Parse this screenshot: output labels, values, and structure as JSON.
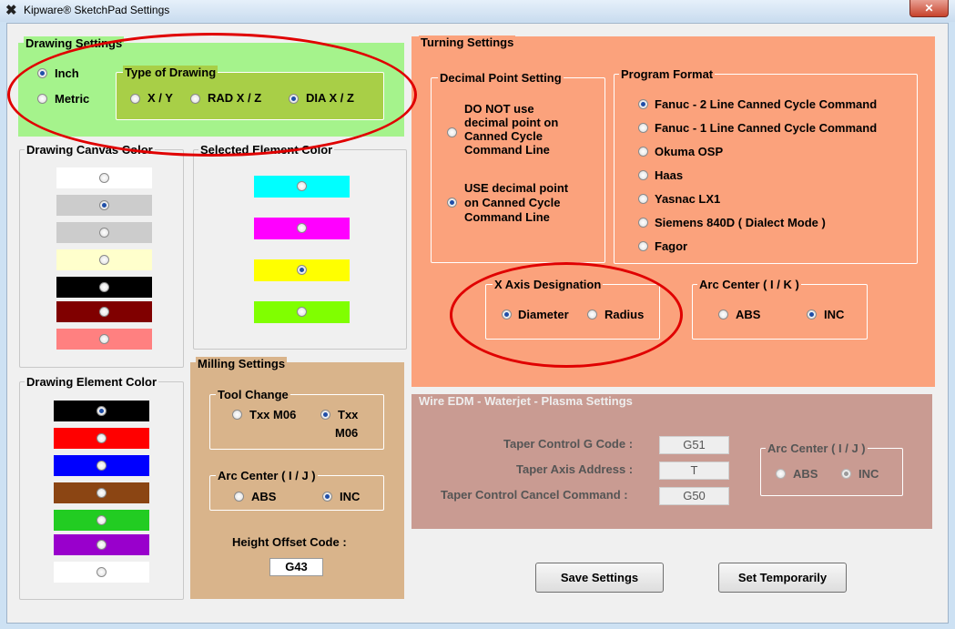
{
  "window": {
    "title": "Kipware® SketchPad Settings",
    "close_glyph": "✕"
  },
  "drawing_settings": {
    "title": "Drawing Settings",
    "inch": "Inch",
    "metric": "Metric",
    "units_selected": "Inch",
    "type_title": "Type of Drawing",
    "types": [
      "X / Y",
      "RAD X / Z",
      "DIA X / Z"
    ],
    "type_selected": "DIA X / Z"
  },
  "canvas_color": {
    "title": "Drawing Canvas Color",
    "colors": [
      "#ffffff",
      "#cccccc",
      "#cccccc",
      "#ffffcc",
      "#000000",
      "#800000",
      "#ff8080"
    ],
    "selected_index": 1
  },
  "selected_element_color": {
    "title": "Selected Element Color",
    "colors": [
      "#00ffff",
      "#ff00ff",
      "#ffff00",
      "#80ff00"
    ],
    "selected_index": 2
  },
  "element_color": {
    "title": "Drawing Element Color",
    "colors": [
      "#000000",
      "#ff0000",
      "#0000ff",
      "#8b4513",
      "#22cc22",
      "#9900cc",
      "#ffffff"
    ],
    "selected_index": 0
  },
  "milling": {
    "title": "Milling Settings",
    "tool_change_title": "Tool Change",
    "tool_change_a": "Txx M06",
    "tool_change_b_1": "Txx",
    "tool_change_b_2": "M06",
    "tool_change_selected": "Txx",
    "arc_title": "Arc Center ( I / J )",
    "abs": "ABS",
    "inc": "INC",
    "arc_selected": "INC",
    "height_label": "Height Offset Code :",
    "height_value": "G43"
  },
  "turning": {
    "title": "Turning Settings",
    "decimal_title": "Decimal Point Setting",
    "decimal_options": [
      [
        "DO NOT use",
        "decimal point on",
        "Canned Cycle",
        "Command Line"
      ],
      [
        "USE decimal point",
        "on Canned Cycle",
        "Command Line"
      ]
    ],
    "decimal_selected_index": 1,
    "program_title": "Program Format",
    "program_options": [
      "Fanuc - 2 Line Canned Cycle Command",
      "Fanuc - 1 Line Canned Cycle Command",
      "Okuma OSP",
      "Haas",
      "Yasnac LX1",
      "Siemens 840D ( Dialect Mode )",
      "Fagor"
    ],
    "program_selected_index": 0,
    "x_axis_title": "X Axis Designation",
    "diameter": "Diameter",
    "radius": "Radius",
    "x_axis_selected": "Diameter",
    "arc_title": "Arc Center ( I / K )",
    "abs": "ABS",
    "inc": "INC",
    "arc_selected": "INC"
  },
  "wire_edm": {
    "title": "Wire EDM - Waterjet - Plasma Settings",
    "taper_code_label": "Taper Control G Code :",
    "taper_code_value": "G51",
    "taper_axis_label": "Taper Axis Address :",
    "taper_axis_value": "T",
    "taper_cancel_label": "Taper Control Cancel Command :",
    "taper_cancel_value": "G50",
    "arc_title": "Arc Center ( I / J )",
    "abs": "ABS",
    "inc": "INC",
    "arc_selected": "INC"
  },
  "buttons": {
    "save": "Save Settings",
    "temp": "Set Temporarily"
  },
  "colors": {
    "drawing_bg": "#a5f38c",
    "type_bg": "#a8cf47",
    "turning_bg": "#fba27c",
    "milling_bg": "#d9b48b",
    "wire_bg": "#c99b92",
    "annotation": "#e00000"
  }
}
